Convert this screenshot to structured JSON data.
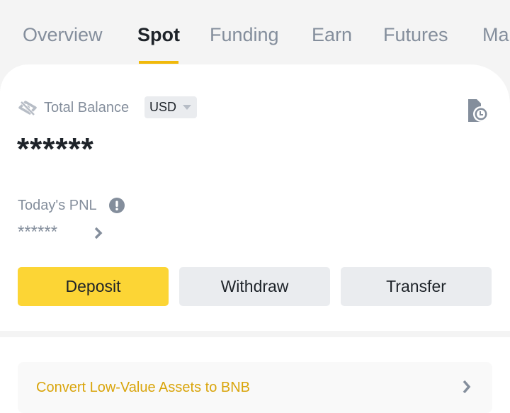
{
  "tabs": [
    {
      "label": "Overview",
      "active": false
    },
    {
      "label": "Spot",
      "active": true
    },
    {
      "label": "Funding",
      "active": false
    },
    {
      "label": "Earn",
      "active": false
    },
    {
      "label": "Futures",
      "active": false
    },
    {
      "label": "Ma",
      "active": false
    }
  ],
  "balance": {
    "label": "Total Balance",
    "currency": "USD",
    "value": "******",
    "visibility_icon": "eye-slash-icon",
    "history_icon": "document-clock-icon"
  },
  "pnl": {
    "label": "Today's PNL",
    "value": "******",
    "info_icon": "exclamation-circle-icon"
  },
  "actions": {
    "deposit": "Deposit",
    "withdraw": "Withdraw",
    "transfer": "Transfer"
  },
  "convert": {
    "label": "Convert Low-Value Assets to BNB"
  },
  "colors": {
    "accent": "#fcd535",
    "tab_underline": "#f0b90b",
    "link_gold": "#d9a50c",
    "muted_text": "#848e9c",
    "primary_text": "#1e2329"
  }
}
